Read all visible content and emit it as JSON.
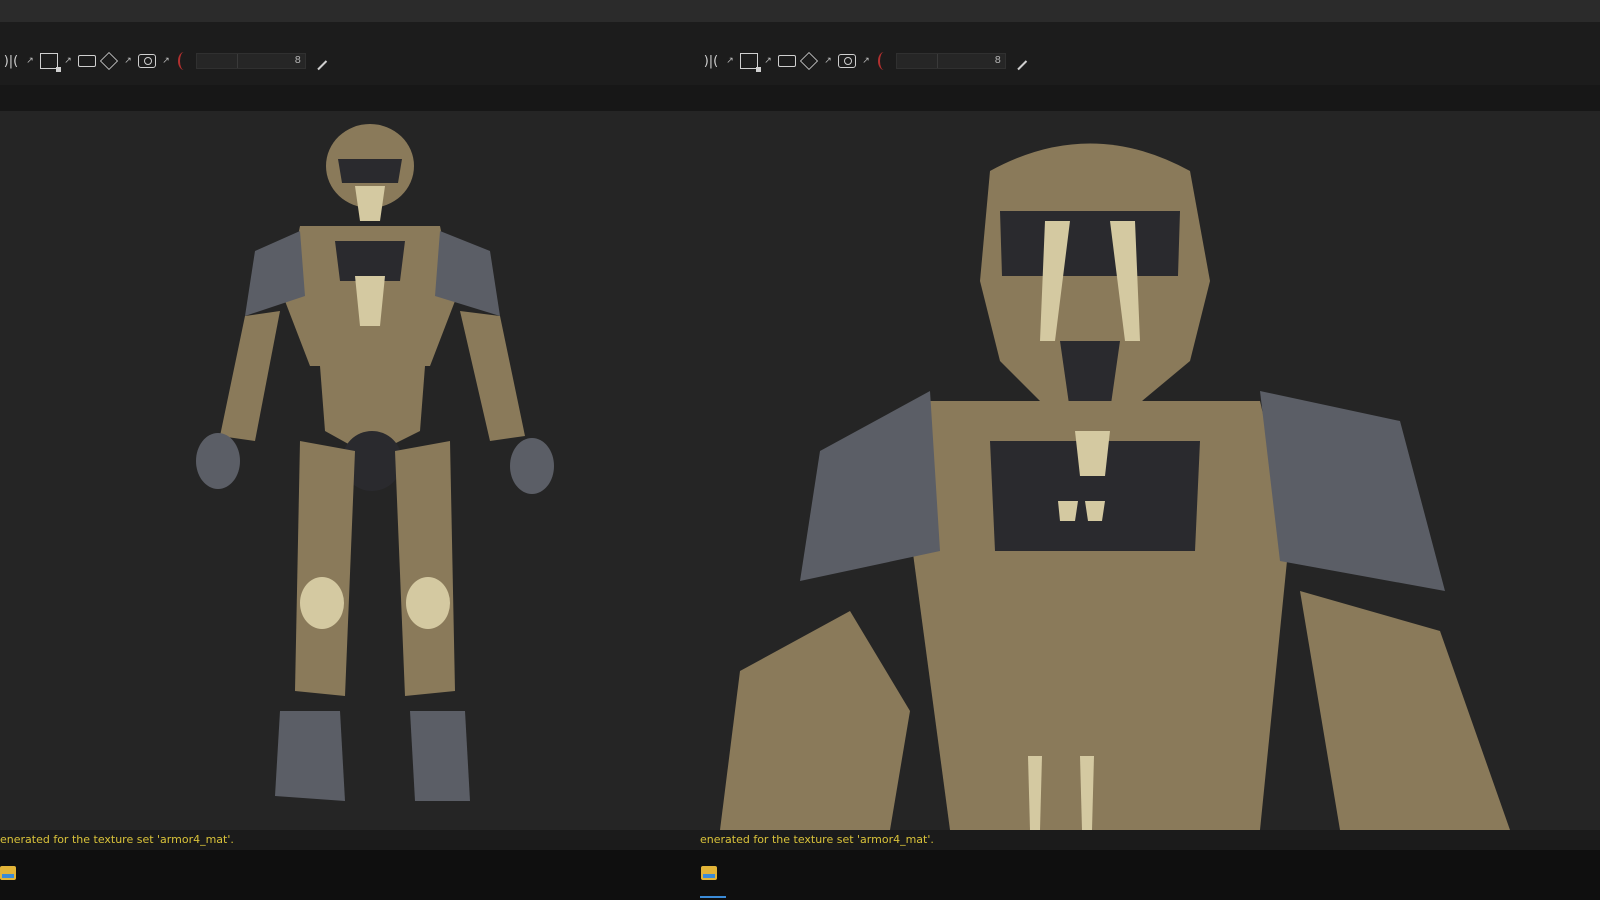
{
  "window": {
    "panes": [
      {
        "id": "left",
        "toolbar": {
          "slider_value": "8",
          "icons": [
            "symmetry-icon",
            "external-link-icon",
            "cube-view-icon",
            "external-link-icon",
            "camera-icon",
            "cube-icon",
            "external-link-icon",
            "screenshot-icon",
            "external-link-icon",
            "brush-icon",
            "pencil-icon"
          ]
        },
        "status_message": "enerated for the texture set 'armor4_mat'."
      },
      {
        "id": "right",
        "toolbar": {
          "slider_value": "8",
          "icons": [
            "symmetry-icon",
            "external-link-icon",
            "cube-view-icon",
            "external-link-icon",
            "camera-icon",
            "cube-icon",
            "external-link-icon",
            "screenshot-icon",
            "external-link-icon",
            "brush-icon",
            "pencil-icon"
          ]
        },
        "status_message": "enerated for the texture set 'armor4_mat'."
      }
    ]
  },
  "colors": {
    "status_text": "#d9c23a",
    "viewport_bg": "#252525",
    "toolbar_bg": "#1c1c1c",
    "accent_red": "#b2302f",
    "taskbar_accent": "#3b8bd8"
  }
}
